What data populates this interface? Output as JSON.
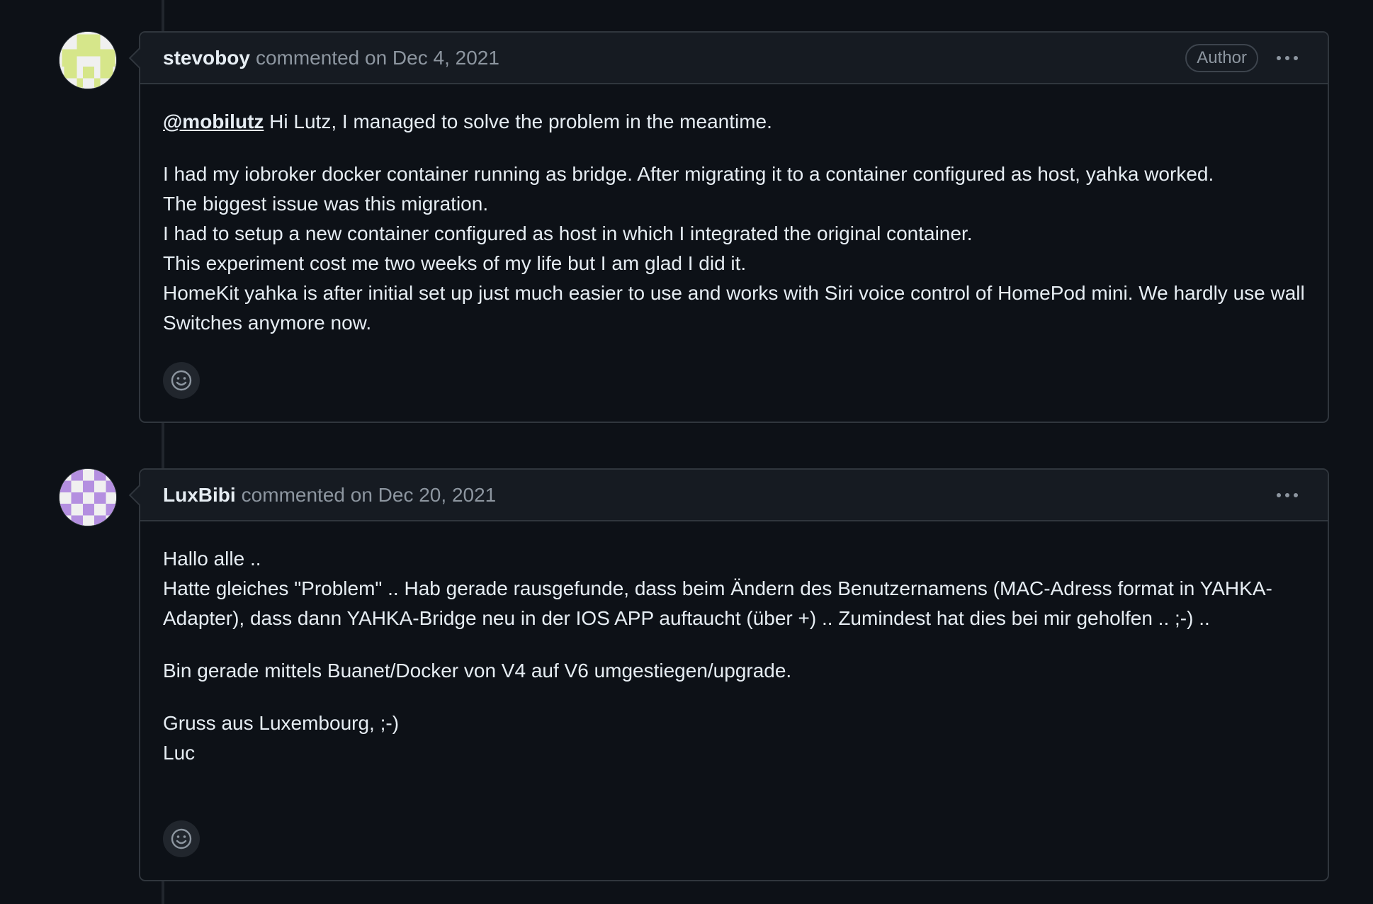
{
  "comments": [
    {
      "author": "stevoboy",
      "meta": "commented on Dec 4, 2021",
      "badge": "Author",
      "mention": "@mobilutz",
      "p1_rest": " Hi Lutz, I managed to solve the problem in the meantime.",
      "lines": [
        "I had my iobroker docker container running as bridge. After migrating it to a container configured as host, yahka worked.",
        "The biggest issue was this migration.",
        "I had to setup a new container configured as host in which I integrated the original container.",
        "This experiment cost me two weeks of my life but I am glad I did it.",
        "HomeKit yahka is after initial set up just much easier to use and works with Siri voice control of HomePod mini. We hardly use wall Switches anymore now."
      ]
    },
    {
      "author": "LuxBibi",
      "meta": "commented on Dec 20, 2021",
      "para1": [
        "Hallo alle ..",
        "Hatte gleiches \"Problem\" .. Hab gerade rausgefunde, dass beim Ändern des Benutzernamens (MAC-Adress format in YAHKA-Adapter), dass dann YAHKA-Bridge neu in der IOS APP auftaucht (über +) .. Zumindest hat dies bei mir geholfen .. ;-) .."
      ],
      "para2": "Bin gerade mittels Buanet/Docker von V4 auf V6 umgestiegen/upgrade.",
      "para3": [
        "Gruss aus Luxembourg, ;-)",
        "Luc"
      ]
    }
  ],
  "colors": {
    "background": "#0d1117",
    "header_bg": "#161b22",
    "border": "#30363d",
    "muted_text": "#8d96a0",
    "avatar1": "#d6e68a",
    "avatar2": "#b48fe0"
  },
  "icons": [
    "kebab-horizontal-icon",
    "smiley-icon"
  ]
}
